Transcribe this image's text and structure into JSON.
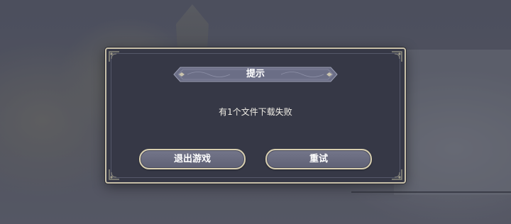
{
  "dialog": {
    "title": "提示",
    "message": "有1个文件下载失败",
    "buttons": {
      "exit_label": "退出游戏",
      "retry_label": "重试"
    }
  },
  "colors": {
    "dialog_bg": "#363846",
    "dialog_border": "#c8c0a8",
    "button_fill": "#6a6c80",
    "button_border": "#d8cfb0",
    "banner_fill": "#6b6e86"
  }
}
